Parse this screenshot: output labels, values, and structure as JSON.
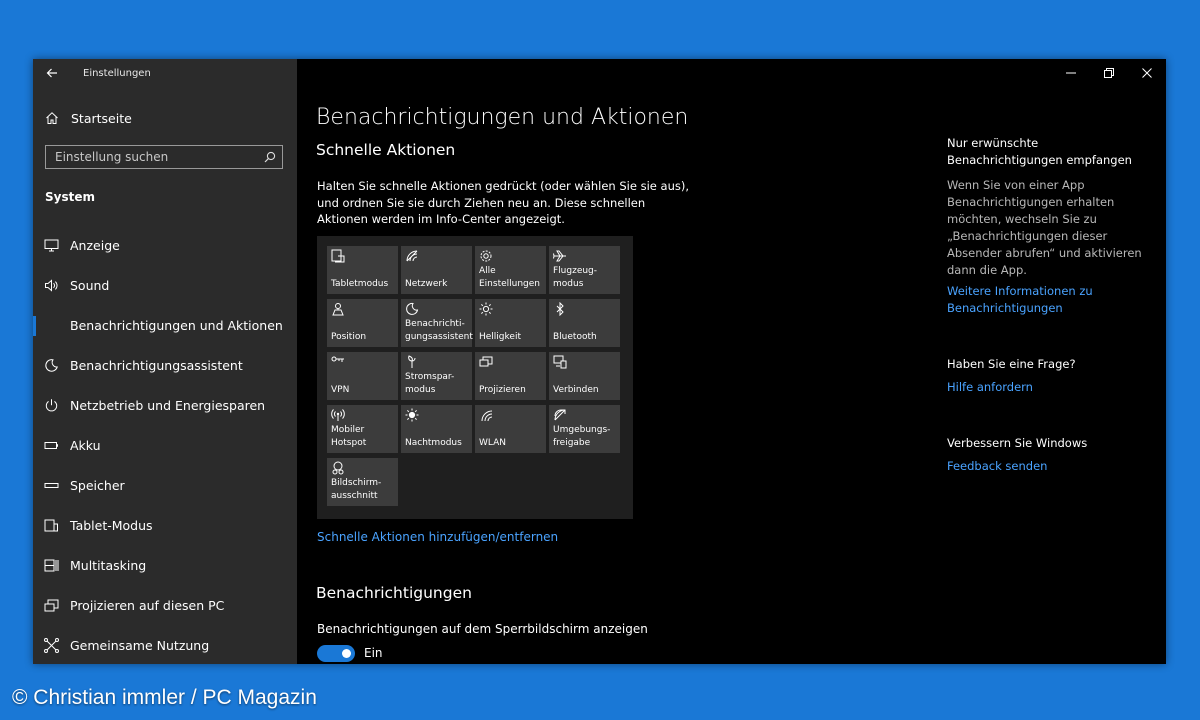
{
  "window": {
    "title": "Einstellungen"
  },
  "sidebar": {
    "home": "Startseite",
    "search_placeholder": "Einstellung suchen",
    "section": "System",
    "items": [
      {
        "label": "Anzeige",
        "icon": "display-icon"
      },
      {
        "label": "Sound",
        "icon": "speaker-icon"
      },
      {
        "label": "Benachrichtigungen und Aktionen",
        "icon": "notification-icon",
        "active": true
      },
      {
        "label": "Benachrichtigungsassistent",
        "icon": "moon-icon"
      },
      {
        "label": "Netzbetrieb und Energiesparen",
        "icon": "power-icon"
      },
      {
        "label": "Akku",
        "icon": "battery-icon"
      },
      {
        "label": "Speicher",
        "icon": "storage-icon"
      },
      {
        "label": "Tablet-Modus",
        "icon": "tablet-icon"
      },
      {
        "label": "Multitasking",
        "icon": "multitasking-icon"
      },
      {
        "label": "Projizieren auf diesen PC",
        "icon": "project-icon"
      },
      {
        "label": "Gemeinsame Nutzung",
        "icon": "share-icon"
      }
    ]
  },
  "main": {
    "title": "Benachrichtigungen und Aktionen",
    "quick_actions_heading": "Schnelle Aktionen",
    "quick_actions_desc": "Halten Sie schnelle Aktionen gedrückt (oder wählen Sie sie aus), und ordnen Sie sie durch Ziehen neu an. Diese schnellen Aktionen werden im Info-Center angezeigt.",
    "tiles": [
      {
        "label": "Tabletmodus",
        "icon": "tablet-mode-icon"
      },
      {
        "label": "Netzwerk",
        "icon": "network-icon"
      },
      {
        "label": "Alle\nEinstellungen",
        "icon": "gear-icon"
      },
      {
        "label": "Flugzeug-\nmodus",
        "icon": "airplane-icon"
      },
      {
        "label": "Position",
        "icon": "location-icon"
      },
      {
        "label": "Benachrichti-\ngungsassistent",
        "icon": "moon-icon"
      },
      {
        "label": "Helligkeit",
        "icon": "brightness-icon"
      },
      {
        "label": "Bluetooth",
        "icon": "bluetooth-icon"
      },
      {
        "label": "VPN",
        "icon": "vpn-icon"
      },
      {
        "label": "Stromspar-\nmodus",
        "icon": "battery-saver-icon"
      },
      {
        "label": "Projizieren",
        "icon": "project-icon"
      },
      {
        "label": "Verbinden",
        "icon": "connect-icon"
      },
      {
        "label": "Mobiler\nHotspot",
        "icon": "hotspot-icon"
      },
      {
        "label": "Nachtmodus",
        "icon": "night-light-icon"
      },
      {
        "label": "WLAN",
        "icon": "wifi-icon"
      },
      {
        "label": "Umgebungs-\nfreigabe",
        "icon": "nearby-share-icon"
      },
      {
        "label": "Bildschirm-\nausschnitt",
        "icon": "snip-icon"
      }
    ],
    "add_remove_link": "Schnelle Aktionen hinzufügen/entfernen",
    "notifications_heading": "Benachrichtigungen",
    "lockscreen_label": "Benachrichtigungen auf dem Sperrbildschirm anzeigen",
    "lockscreen_toggle": "Ein"
  },
  "right": {
    "block1_heading": "Nur erwünschte Benachrichtigungen empfangen",
    "block1_text": "Wenn Sie von einer App Benachrichtigungen erhalten möchten, wechseln Sie zu „Benachrichtigungen dieser Absender abrufen“ und aktivieren dann die App.",
    "block1_link": "Weitere Informationen zu Benachrichtigungen",
    "block2_heading": "Haben Sie eine Frage?",
    "block2_link": "Hilfe anfordern",
    "block3_heading": "Verbessern Sie Windows",
    "block3_link": "Feedback senden"
  },
  "copyright": "© Christian immler / PC Magazin",
  "colors": {
    "accent": "#1a78d6",
    "link": "#4aa3ff",
    "sidebar_bg": "#2b2b2b",
    "tile_bg": "#3c3c3c"
  }
}
